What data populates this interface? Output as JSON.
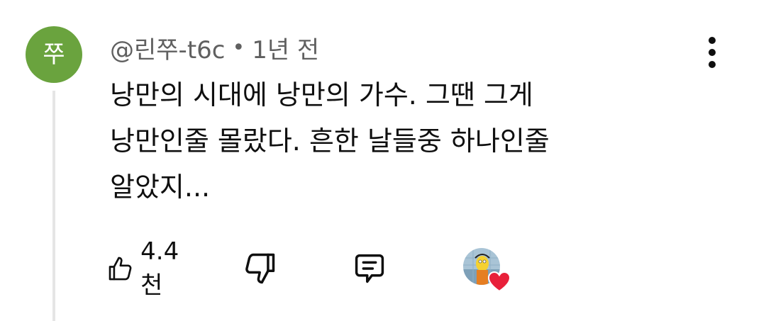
{
  "comment": {
    "author_initial": "쭈",
    "author_handle": "@린쭈-t6c",
    "separator": "•",
    "timestamp": "1년 전",
    "text_lines": [
      "낭만의 시대에 낭만의 가수. 그땐 그게",
      "낭만인줄 몰랐다. 흔한 날들중 하나인줄",
      "알았지..."
    ],
    "like_count": "4.4천",
    "creator_hearted": true
  },
  "icons": {
    "more": "more-vertical-icon",
    "like": "thumbs-up-icon",
    "dislike": "thumbs-down-icon",
    "reply": "reply-comment-icon",
    "heart": "heart-icon"
  },
  "colors": {
    "avatar_bg": "#6aa33e",
    "heart": "#e8203a",
    "meta_text": "#606060",
    "thread_line": "#e5e5e5"
  }
}
